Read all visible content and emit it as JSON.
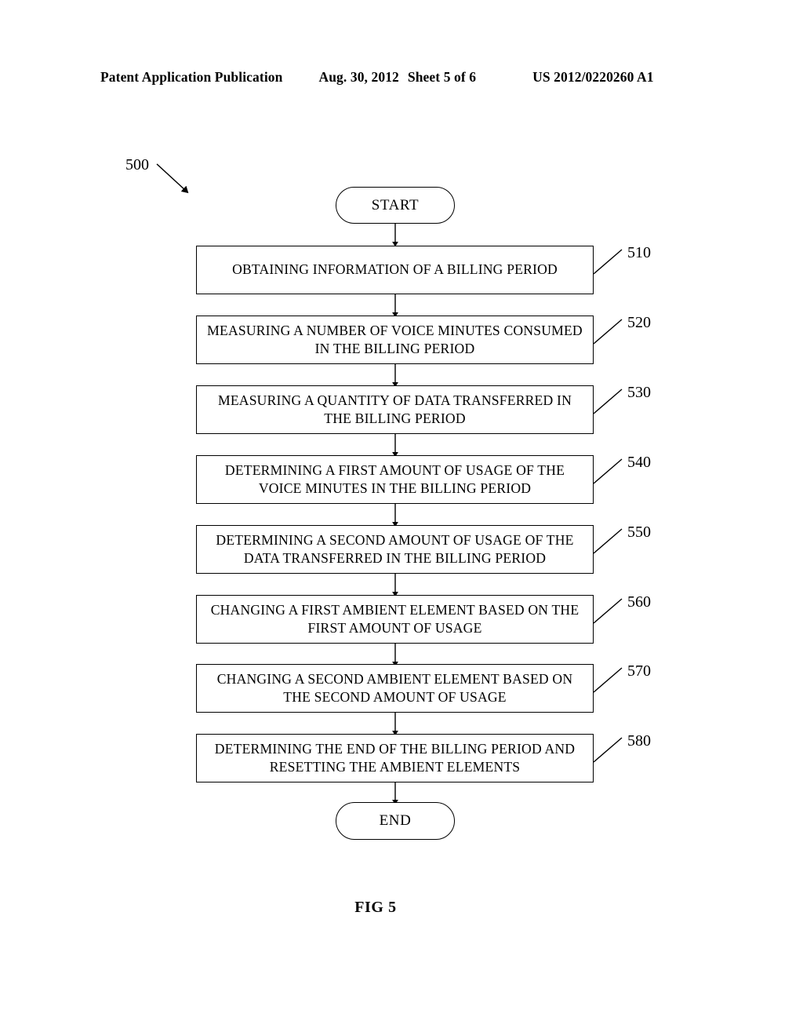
{
  "header": {
    "publication": "Patent Application Publication",
    "date": "Aug. 30, 2012",
    "sheet": "Sheet 5 of 6",
    "publication_number": "US 2012/0220260 A1"
  },
  "figure": {
    "caption": "FIG 5",
    "diagram_reference": "500"
  },
  "flowchart": {
    "start_label": "START",
    "end_label": "END",
    "steps": [
      {
        "ref": "510",
        "text": "OBTAINING INFORMATION OF A BILLING PERIOD"
      },
      {
        "ref": "520",
        "text": "MEASURING A NUMBER OF VOICE MINUTES CONSUMED IN THE BILLING PERIOD"
      },
      {
        "ref": "530",
        "text": "MEASURING A QUANTITY OF DATA TRANSFERRED IN THE BILLING PERIOD"
      },
      {
        "ref": "540",
        "text": "DETERMINING A FIRST AMOUNT OF USAGE OF THE VOICE MINUTES IN THE BILLING PERIOD"
      },
      {
        "ref": "550",
        "text": "DETERMINING A SECOND AMOUNT OF USAGE OF THE DATA TRANSFERRED IN THE BILLING PERIOD"
      },
      {
        "ref": "560",
        "text": "CHANGING A FIRST AMBIENT ELEMENT BASED ON THE FIRST AMOUNT OF USAGE"
      },
      {
        "ref": "570",
        "text": "CHANGING A SECOND AMBIENT ELEMENT BASED ON THE SECOND AMOUNT OF USAGE"
      },
      {
        "ref": "580",
        "text": "DETERMINING THE END OF THE BILLING PERIOD AND RESETTING THE AMBIENT ELEMENTS"
      }
    ]
  }
}
